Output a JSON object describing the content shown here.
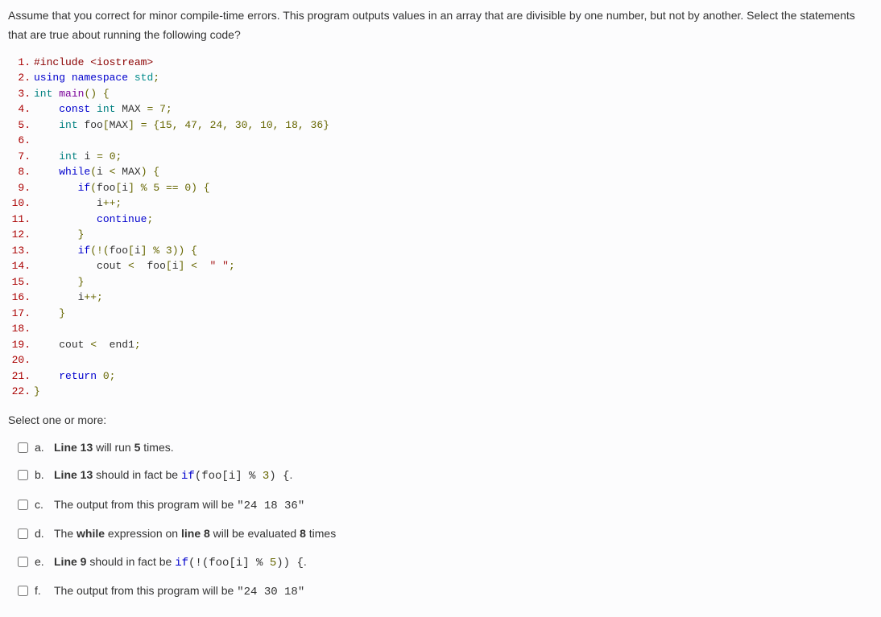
{
  "question": {
    "intro": "Assume that you correct for minor compile-time errors. This program outputs values in an array that are divisible by one number, but not by another. Select the statements that are true about running the following code?"
  },
  "code": {
    "lines": [
      {
        "n": "1.",
        "html": "<span class='kw-include'>#include &lt;iostream&gt;</span>"
      },
      {
        "n": "2.",
        "html": "<span class='kw-blue'>using</span> <span class='kw-blue'>namespace</span> <span class='kw-teal'>std</span><span class='op'>;</span>"
      },
      {
        "n": "3.",
        "html": "<span class='kw-green'>int</span> <span class='kw-purple'>main</span><span class='op'>() {</span>"
      },
      {
        "n": "4.",
        "html": "    <span class='kw-blue'>const</span> <span class='kw-green'>int</span> <span class='ident'>MAX</span> <span class='op'>=</span> <span class='num'>7</span><span class='op'>;</span>"
      },
      {
        "n": "5.",
        "html": "    <span class='kw-green'>int</span> <span class='ident'>foo</span><span class='op'>[</span><span class='ident'>MAX</span><span class='op'>]</span> <span class='op'>=</span> <span class='op'>{</span><span class='num'>15</span><span class='op'>,</span> <span class='num'>47</span><span class='op'>,</span> <span class='num'>24</span><span class='op'>,</span> <span class='num'>30</span><span class='op'>,</span> <span class='num'>10</span><span class='op'>,</span> <span class='num'>18</span><span class='op'>,</span> <span class='num'>36</span><span class='op'>}</span>"
      },
      {
        "n": "6.",
        "html": ""
      },
      {
        "n": "7.",
        "html": "    <span class='kw-green'>int</span> <span class='ident'>i</span> <span class='op'>=</span> <span class='num'>0</span><span class='op'>;</span>"
      },
      {
        "n": "8.",
        "html": "    <span class='kw-blue'>while</span><span class='op'>(</span><span class='ident'>i</span> <span class='op'>&lt;</span> <span class='ident'>MAX</span><span class='op'>) {</span>"
      },
      {
        "n": "9.",
        "html": "       <span class='kw-blue'>if</span><span class='op'>(</span><span class='ident'>foo</span><span class='op'>[</span><span class='ident'>i</span><span class='op'>]</span> <span class='op'>%</span> <span class='num'>5</span> <span class='op'>==</span> <span class='num'>0</span><span class='op'>) {</span>"
      },
      {
        "n": "10.",
        "html": "          <span class='ident'>i</span><span class='op'>++;</span>"
      },
      {
        "n": "11.",
        "html": "          <span class='kw-blue'>continue</span><span class='op'>;</span>"
      },
      {
        "n": "12.",
        "html": "       <span class='op'>}</span>"
      },
      {
        "n": "13.",
        "html": "       <span class='kw-blue'>if</span><span class='op'>(!(</span><span class='ident'>foo</span><span class='op'>[</span><span class='ident'>i</span><span class='op'>]</span> <span class='op'>%</span> <span class='num'>3</span><span class='op'>)) {</span>"
      },
      {
        "n": "14.",
        "html": "          <span class='ident'>cout</span> <span class='op'>&lt;</span>  <span class='ident'>foo</span><span class='op'>[</span><span class='ident'>i</span><span class='op'>]</span> <span class='op'>&lt;</span>  <span class='str'>\" \"</span><span class='op'>;</span>"
      },
      {
        "n": "15.",
        "html": "       <span class='op'>}</span>"
      },
      {
        "n": "16.",
        "html": "       <span class='ident'>i</span><span class='op'>++;</span>"
      },
      {
        "n": "17.",
        "html": "    <span class='op'>}</span>"
      },
      {
        "n": "18.",
        "html": ""
      },
      {
        "n": "19.",
        "html": "    <span class='ident'>cout</span> <span class='op'>&lt;</span>  <span class='ident'>end1</span><span class='op'>;</span>"
      },
      {
        "n": "20.",
        "html": ""
      },
      {
        "n": "21.",
        "html": "    <span class='kw-blue'>return</span> <span class='num'>0</span><span class='op'>;</span>"
      },
      {
        "n": "22.",
        "html": "<span class='op'>}</span>"
      }
    ]
  },
  "select_prompt": "Select one or more:",
  "options": [
    {
      "letter": "a.",
      "html": "<strong>Line 13</strong> will run <strong>5</strong> times."
    },
    {
      "letter": "b.",
      "html": "<strong>Line 13</strong> should in fact be <span class='inline-code'><span class='kw-blue'>if</span>(foo[i] % <span class='num'>3</span>) {</span>."
    },
    {
      "letter": "c.",
      "html": "The output from this program will be <span class='inline-code'>\"24 18 36\"</span>"
    },
    {
      "letter": "d.",
      "html": "The <strong>while</strong> expression on <strong>line 8</strong> will be evaluated <strong>8</strong> times"
    },
    {
      "letter": "e.",
      "html": "<strong>Line 9</strong> should in fact be <span class='inline-code'><span class='kw-blue'>if</span>(!(foo[i] % <span class='num'>5</span>)) {</span>."
    },
    {
      "letter": "f.",
      "html": "The output from this program will be <span class='inline-code'>\"24 30 18\"</span>"
    }
  ]
}
